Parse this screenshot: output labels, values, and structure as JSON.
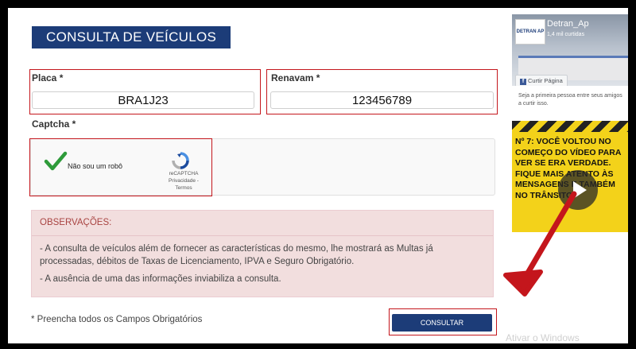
{
  "form": {
    "title": "CONSULTA DE VEÍCULOS",
    "placa_label": "Placa *",
    "placa_value": "BRA1J23",
    "renavam_label": "Renavam *",
    "renavam_value": "123456789",
    "captcha_label": "Captcha *",
    "captcha": {
      "checkbox_label": "Não sou um robô",
      "checked": true,
      "brand": "reCAPTCHA",
      "links": "Privacidade - Termos"
    },
    "obs_title": "OBSERVAÇÕES:",
    "obs_lines": [
      "-  A consulta de veículos além de fornecer as características do mesmo, lhe mostrará as Multas já processadas, débitos de Taxas de Licenciamento, IPVA e Seguro Obrigatório.",
      "-  A ausência de uma das informações inviabiliza a consulta."
    ],
    "required_note": "* Preencha todos os Campos Obrigatórios",
    "submit_label": "CONSULTAR"
  },
  "facebook": {
    "page_name": "Detran_Ap",
    "likes": "1,4 mil curtidas",
    "logo_text": "DETRAN AP",
    "like_button": "Curtir Página",
    "prompt": "Seja a primeira pessoa entre seus amigos a curtir isso."
  },
  "video": {
    "text": "Nº 7: VOCÊ VOLTOU NO COMEÇO DO VÍDEO PARA VER SE ERA VERDADE. FIQUE MAIS ATENTO ÀS MENSAGENS E TAMBÉM NO TRÂNSITO"
  },
  "os_watermark": "Ativar o Windows",
  "colors": {
    "brand_blue": "#1c3c78",
    "highlight_red": "#c4161c",
    "alert_bg": "#f2dede",
    "checkmark_green": "#2e9b3a"
  }
}
